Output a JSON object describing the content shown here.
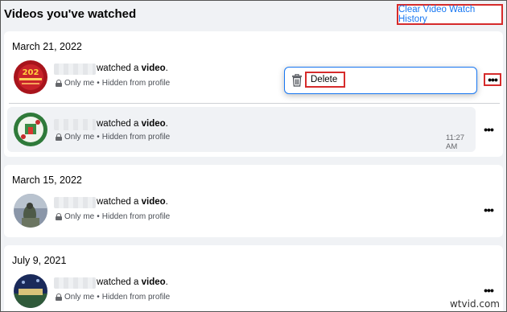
{
  "page": {
    "title": "Videos you've watched",
    "clear_history_label": "Clear Video Watch History"
  },
  "groups": [
    {
      "date": "March 21, 2022",
      "entries": [
        {
          "action": "watched a ",
          "object": "video",
          "end": ".",
          "privacy": "Only me",
          "visibility": "Hidden from profile",
          "time": ""
        },
        {
          "action": "watched a ",
          "object": "video",
          "end": ".",
          "privacy": "Only me",
          "visibility": "Hidden from profile",
          "time": "11:27 AM"
        }
      ]
    },
    {
      "date": "March 15, 2022",
      "entries": [
        {
          "action": "watched a ",
          "object": "video",
          "end": ".",
          "privacy": "Only me",
          "visibility": "Hidden from profile",
          "time": ""
        }
      ]
    },
    {
      "date": "July 9, 2021",
      "entries": [
        {
          "action": "watched a ",
          "object": "video",
          "end": ".",
          "privacy": "Only me",
          "visibility": "Hidden from profile",
          "time": ""
        }
      ]
    }
  ],
  "separator": "•",
  "more_icon": "•••",
  "popup": {
    "delete_label": "Delete",
    "icon": "trash-icon"
  },
  "watermark": "wtvid.com",
  "colors": {
    "accent": "#1877f2",
    "highlight_border": "#d62b2b",
    "background": "#f0f2f5"
  }
}
